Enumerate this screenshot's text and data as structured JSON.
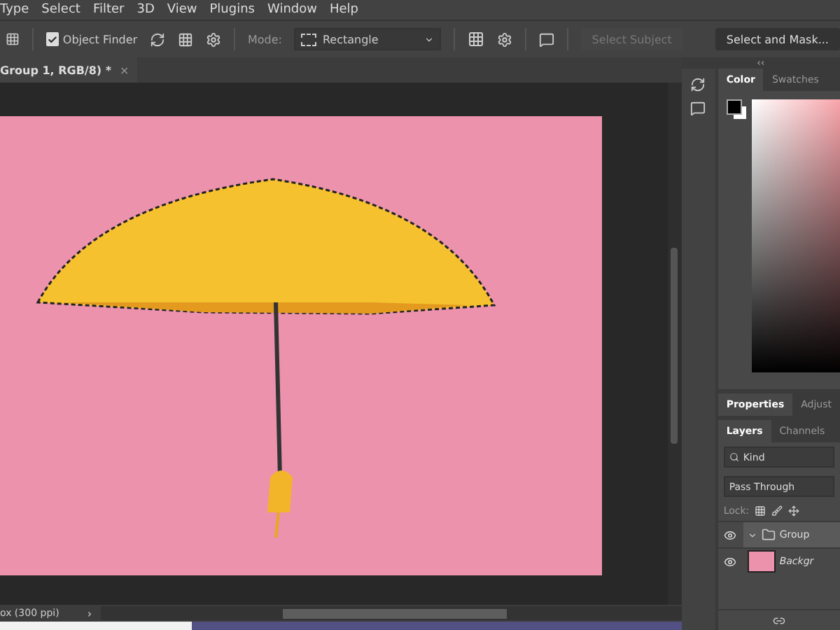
{
  "menu": [
    "Type",
    "Select",
    "Filter",
    "3D",
    "View",
    "Plugins",
    "Window",
    "Help"
  ],
  "options_bar": {
    "object_finder": {
      "label": "Object Finder",
      "checked": true
    },
    "mode": {
      "label": "Mode:",
      "value": "Rectangle"
    },
    "select_subject": {
      "label": "Select Subject",
      "disabled": true
    },
    "select_and_mask": {
      "label": "Select and Mask..."
    }
  },
  "document_tab": {
    "title": "Group 1, RGB/8) *",
    "close": "×"
  },
  "collapse_arrows": "‹‹",
  "color_panel": {
    "tabs": [
      {
        "label": "Color",
        "selected": true
      },
      {
        "label": "Swatches",
        "selected": false
      }
    ]
  },
  "properties_panel": {
    "tabs": [
      {
        "label": "Properties",
        "selected": true
      },
      {
        "label": "Adjust",
        "selected": false
      }
    ]
  },
  "layers_panel": {
    "tabs": [
      {
        "label": "Layers",
        "selected": true
      },
      {
        "label": "Channels",
        "selected": false
      }
    ],
    "filter": "Kind",
    "blend_mode": "Pass Through",
    "lock_label": "Lock:",
    "layers": [
      {
        "name": "Group",
        "kind": "group",
        "visible": true,
        "selected": true
      },
      {
        "name": "Backgr",
        "kind": "pixel",
        "visible": true,
        "selected": false
      }
    ]
  },
  "status_bar": {
    "info": "ox (300 ppi)",
    "arrow": "›"
  }
}
